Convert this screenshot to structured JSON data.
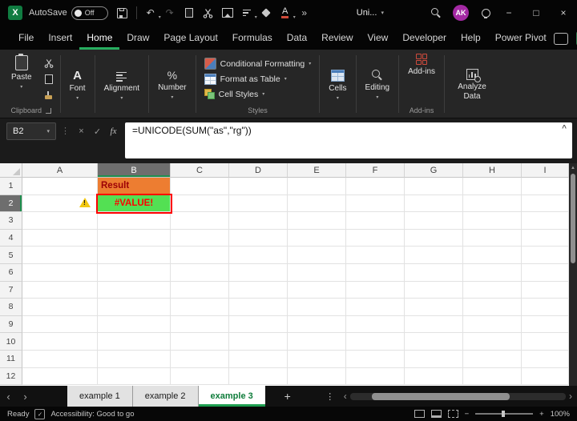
{
  "titlebar": {
    "app": "Excel",
    "autosave_label": "AutoSave",
    "autosave_state": "Off",
    "doc_name": "Uni...",
    "avatar_initials": "AK"
  },
  "menubar": {
    "items": [
      "File",
      "Insert",
      "Home",
      "Draw",
      "Page Layout",
      "Formulas",
      "Data",
      "Review",
      "View",
      "Developer",
      "Help",
      "Power Pivot"
    ],
    "active": "Home"
  },
  "ribbon": {
    "paste_label": "Paste",
    "clipboard_group_label": "Clipboard",
    "font_label": "Font",
    "alignment_label": "Alignment",
    "number_label": "Number",
    "conditional_formatting_label": "Conditional Formatting",
    "format_as_table_label": "Format as Table",
    "cell_styles_label": "Cell Styles",
    "styles_group_label": "Styles",
    "cells_label": "Cells",
    "editing_label": "Editing",
    "addins_label": "Add-ins",
    "addins_group_label": "Add-ins",
    "analyze_data_label": "Analyze Data"
  },
  "formula_bar": {
    "name_box_value": "B2",
    "formula": "=UNICODE(SUM(\"as\",\"rg\"))",
    "fx_label": "fx"
  },
  "grid": {
    "column_headers": [
      "A",
      "B",
      "C",
      "D",
      "E",
      "F",
      "G",
      "H",
      "I"
    ],
    "row_headers": [
      "1",
      "2",
      "3",
      "4",
      "5",
      "6",
      "7",
      "8",
      "9",
      "10",
      "11",
      "12"
    ],
    "selected_column": "B",
    "selected_row": "2",
    "selected_cell": "B2",
    "cells": {
      "B1": "Result",
      "B2": "#VALUE!"
    },
    "cell_styles": {
      "B1": {
        "bg": "#ED7D31",
        "color": "#9C0006",
        "bold": true,
        "align": "left"
      },
      "B2": {
        "bg": "#53E053",
        "color": "#FF0000",
        "bold": true,
        "align": "center",
        "outline": "#FF0000"
      }
    },
    "indicators": {
      "A2": "error-warning"
    }
  },
  "sheet_tabs": {
    "tabs": [
      "example 1",
      "example 2",
      "example 3"
    ],
    "active": "example 3"
  },
  "statusbar": {
    "mode": "Ready",
    "accessibility": "Accessibility: Good to go",
    "zoom": "100%"
  },
  "colors": {
    "accent_green": "#27AE60",
    "excel_green": "#107C41",
    "addins_red": "#CF4A3C",
    "result_bg": "#ED7D31",
    "result_text": "#9C0006",
    "value_bg": "#53E053",
    "error_red": "#FF0000",
    "avatar_bg": "#A429A4",
    "warning_yellow": "#F2C811"
  }
}
